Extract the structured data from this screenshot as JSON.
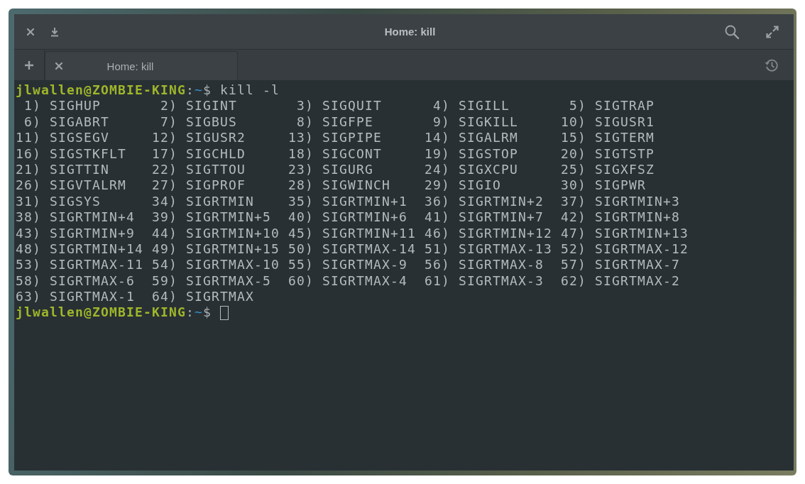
{
  "window": {
    "title": "Home: kill"
  },
  "tabs": [
    {
      "label": "Home: kill",
      "selected": true
    }
  ],
  "terminal": [
    {
      "kind": "prompt",
      "user_host": "jlwallen@ZOMBIE-KING",
      "separator": ":",
      "path": "~",
      "symbol": "$",
      "command": "kill -l",
      "cursor": false
    },
    {
      "kind": "signal_table",
      "entries": [
        {
          "number": "1)",
          "name": "SIGHUP"
        },
        {
          "number": "2)",
          "name": "SIGINT"
        },
        {
          "number": "3)",
          "name": "SIGQUIT"
        },
        {
          "number": "4)",
          "name": "SIGILL"
        },
        {
          "number": "5)",
          "name": "SIGTRAP"
        },
        {
          "number": "6)",
          "name": "SIGABRT"
        },
        {
          "number": "7)",
          "name": "SIGBUS"
        },
        {
          "number": "8)",
          "name": "SIGFPE"
        },
        {
          "number": "9)",
          "name": "SIGKILL"
        },
        {
          "number": "10)",
          "name": "SIGUSR1"
        },
        {
          "number": "11)",
          "name": "SIGSEGV"
        },
        {
          "number": "12)",
          "name": "SIGUSR2"
        },
        {
          "number": "13)",
          "name": "SIGPIPE"
        },
        {
          "number": "14)",
          "name": "SIGALRM"
        },
        {
          "number": "15)",
          "name": "SIGTERM"
        },
        {
          "number": "16)",
          "name": "SIGSTKFLT"
        },
        {
          "number": "17)",
          "name": "SIGCHLD"
        },
        {
          "number": "18)",
          "name": "SIGCONT"
        },
        {
          "number": "19)",
          "name": "SIGSTOP"
        },
        {
          "number": "20)",
          "name": "SIGTSTP"
        },
        {
          "number": "21)",
          "name": "SIGTTIN"
        },
        {
          "number": "22)",
          "name": "SIGTTOU"
        },
        {
          "number": "23)",
          "name": "SIGURG"
        },
        {
          "number": "24)",
          "name": "SIGXCPU"
        },
        {
          "number": "25)",
          "name": "SIGXFSZ"
        },
        {
          "number": "26)",
          "name": "SIGVTALRM"
        },
        {
          "number": "27)",
          "name": "SIGPROF"
        },
        {
          "number": "28)",
          "name": "SIGWINCH"
        },
        {
          "number": "29)",
          "name": "SIGIO"
        },
        {
          "number": "30)",
          "name": "SIGPWR"
        },
        {
          "number": "31)",
          "name": "SIGSYS"
        },
        {
          "number": "34)",
          "name": "SIGRTMIN"
        },
        {
          "number": "35)",
          "name": "SIGRTMIN+1"
        },
        {
          "number": "36)",
          "name": "SIGRTMIN+2"
        },
        {
          "number": "37)",
          "name": "SIGRTMIN+3"
        },
        {
          "number": "38)",
          "name": "SIGRTMIN+4"
        },
        {
          "number": "39)",
          "name": "SIGRTMIN+5"
        },
        {
          "number": "40)",
          "name": "SIGRTMIN+6"
        },
        {
          "number": "41)",
          "name": "SIGRTMIN+7"
        },
        {
          "number": "42)",
          "name": "SIGRTMIN+8"
        },
        {
          "number": "43)",
          "name": "SIGRTMIN+9"
        },
        {
          "number": "44)",
          "name": "SIGRTMIN+10"
        },
        {
          "number": "45)",
          "name": "SIGRTMIN+11"
        },
        {
          "number": "46)",
          "name": "SIGRTMIN+12"
        },
        {
          "number": "47)",
          "name": "SIGRTMIN+13"
        },
        {
          "number": "48)",
          "name": "SIGRTMIN+14"
        },
        {
          "number": "49)",
          "name": "SIGRTMIN+15"
        },
        {
          "number": "50)",
          "name": "SIGRTMAX-14"
        },
        {
          "number": "51)",
          "name": "SIGRTMAX-13"
        },
        {
          "number": "52)",
          "name": "SIGRTMAX-12"
        },
        {
          "number": "53)",
          "name": "SIGRTMAX-11"
        },
        {
          "number": "54)",
          "name": "SIGRTMAX-10"
        },
        {
          "number": "55)",
          "name": "SIGRTMAX-9"
        },
        {
          "number": "56)",
          "name": "SIGRTMAX-8"
        },
        {
          "number": "57)",
          "name": "SIGRTMAX-7"
        },
        {
          "number": "58)",
          "name": "SIGRTMAX-6"
        },
        {
          "number": "59)",
          "name": "SIGRTMAX-5"
        },
        {
          "number": "60)",
          "name": "SIGRTMAX-4"
        },
        {
          "number": "61)",
          "name": "SIGRTMAX-3"
        },
        {
          "number": "62)",
          "name": "SIGRTMAX-2"
        },
        {
          "number": "63)",
          "name": "SIGRTMAX-1"
        },
        {
          "number": "64)",
          "name": "SIGRTMAX"
        }
      ]
    },
    {
      "kind": "prompt",
      "user_host": "jlwallen@ZOMBIE-KING",
      "separator": ":",
      "path": "~",
      "symbol": "$",
      "cursor": true
    }
  ]
}
